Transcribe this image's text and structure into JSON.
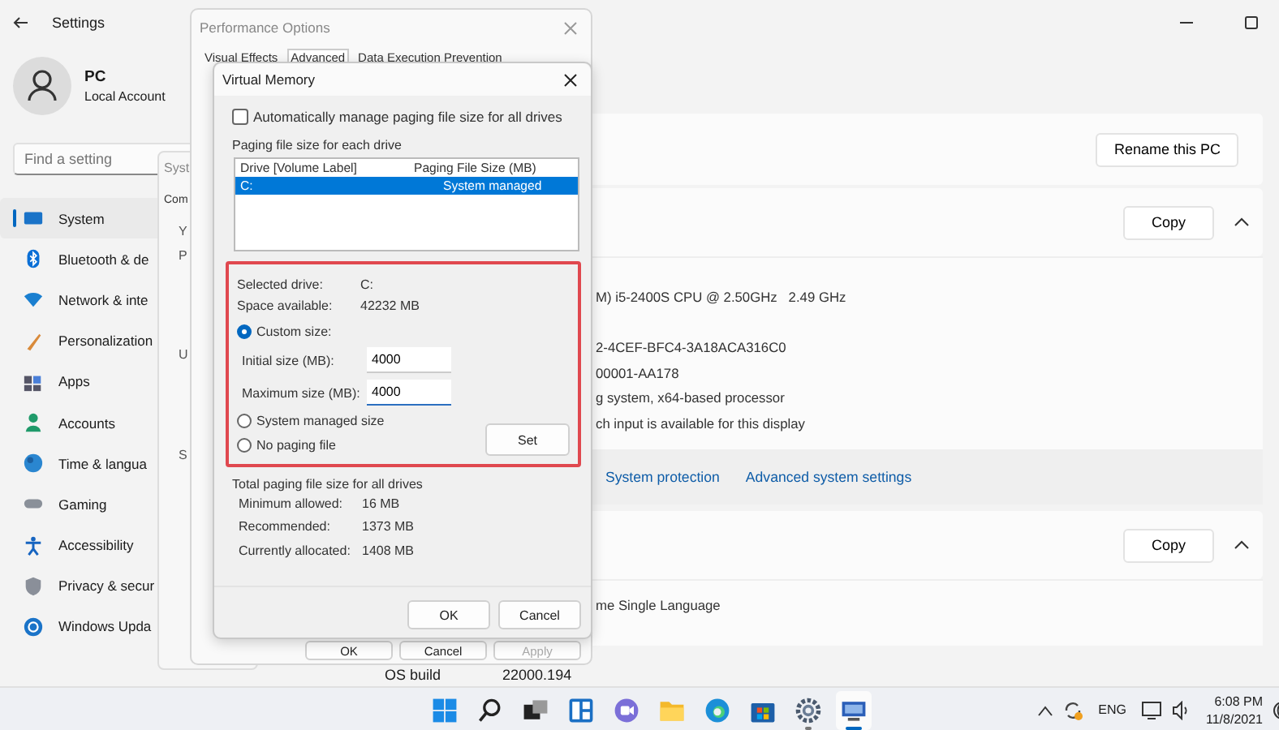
{
  "settings": {
    "title": "Settings",
    "profile": {
      "name": "PC",
      "account": "Local Account"
    },
    "search": {
      "placeholder": "Find a setting"
    },
    "nav": [
      {
        "label": "System",
        "selected": true
      },
      {
        "label": "Bluetooth & de",
        "selected": false
      },
      {
        "label": "Network & inte",
        "selected": false
      },
      {
        "label": "Personalization",
        "selected": false
      },
      {
        "label": "Apps",
        "selected": false
      },
      {
        "label": "Accounts",
        "selected": false
      },
      {
        "label": "Time & langua",
        "selected": false
      },
      {
        "label": "Gaming",
        "selected": false
      },
      {
        "label": "Accessibility",
        "selected": false
      },
      {
        "label": "Privacy & secur",
        "selected": false
      },
      {
        "label": "Windows Upda",
        "selected": false
      }
    ],
    "rename_button": "Rename this PC",
    "device_specs": {
      "copy_button": "Copy",
      "lines": [
        "M) i5-2400S CPU @ 2.50GHz   2.49 GHz",
        "2-4CEF-BFC4-3A18ACA316C0",
        "00001-AA178",
        "g system, x64-based processor",
        "ch input is available for this display"
      ]
    },
    "links": [
      "System protection",
      "Advanced system settings"
    ],
    "windows_specs": {
      "copy_button": "Copy",
      "lines": [
        "me Single Language"
      ]
    },
    "os_build": {
      "label": "OS build",
      "value": "22000.194"
    }
  },
  "system_properties": {
    "title": "Syst",
    "tab": "Com",
    "fragments": [
      "Y",
      "P",
      "U",
      "S"
    ]
  },
  "performance_options": {
    "title": "Performance Options",
    "tabs": [
      {
        "label": "Visual Effects",
        "selected": false
      },
      {
        "label": "Advanced",
        "selected": true
      },
      {
        "label": "Data Execution Prevention",
        "selected": false
      }
    ],
    "buttons": [
      {
        "label": "OK",
        "disabled": false
      },
      {
        "label": "Cancel",
        "disabled": false
      },
      {
        "label": "Apply",
        "disabled": true
      }
    ]
  },
  "virtual_memory": {
    "title": "Virtual Memory",
    "auto_manage": {
      "label": "Automatically manage paging file size for all drives",
      "checked": false
    },
    "group_label": "Paging file size for each drive",
    "columns": [
      "Drive  [Volume Label]",
      "Paging File Size (MB)"
    ],
    "drives": [
      {
        "drive": "C:",
        "size": "System managed",
        "selected": true
      }
    ],
    "selected_drive": {
      "label": "Selected drive:",
      "value": "C:"
    },
    "space": {
      "label": "Space available:",
      "value": "42232 MB"
    },
    "options": [
      {
        "label": "Custom size:",
        "selected": true
      },
      {
        "label": "System managed size",
        "selected": false
      },
      {
        "label": "No paging file",
        "selected": false
      }
    ],
    "initial": {
      "label": "Initial size (MB):",
      "value": "4000"
    },
    "maximum": {
      "label": "Maximum size (MB):",
      "value": "4000"
    },
    "set_button": "Set",
    "total_label": "Total paging file size for all drives",
    "totals": [
      {
        "label": "Minimum allowed:",
        "value": "16 MB"
      },
      {
        "label": "Recommended:",
        "value": "1373 MB"
      },
      {
        "label": "Currently allocated:",
        "value": "1408 MB"
      }
    ],
    "buttons": [
      "OK",
      "Cancel"
    ]
  },
  "taskbar": {
    "apps": [
      {
        "running": false,
        "active": false
      },
      {
        "running": false,
        "active": false
      },
      {
        "running": false,
        "active": false
      },
      {
        "running": false,
        "active": false
      },
      {
        "running": false,
        "active": false
      },
      {
        "running": false,
        "active": false
      },
      {
        "running": false,
        "active": false
      },
      {
        "running": false,
        "active": false
      },
      {
        "running": true,
        "active": false
      },
      {
        "running": true,
        "active": true
      }
    ],
    "language": "ENG",
    "time": "6:08 PM",
    "date": "11/8/2021"
  }
}
